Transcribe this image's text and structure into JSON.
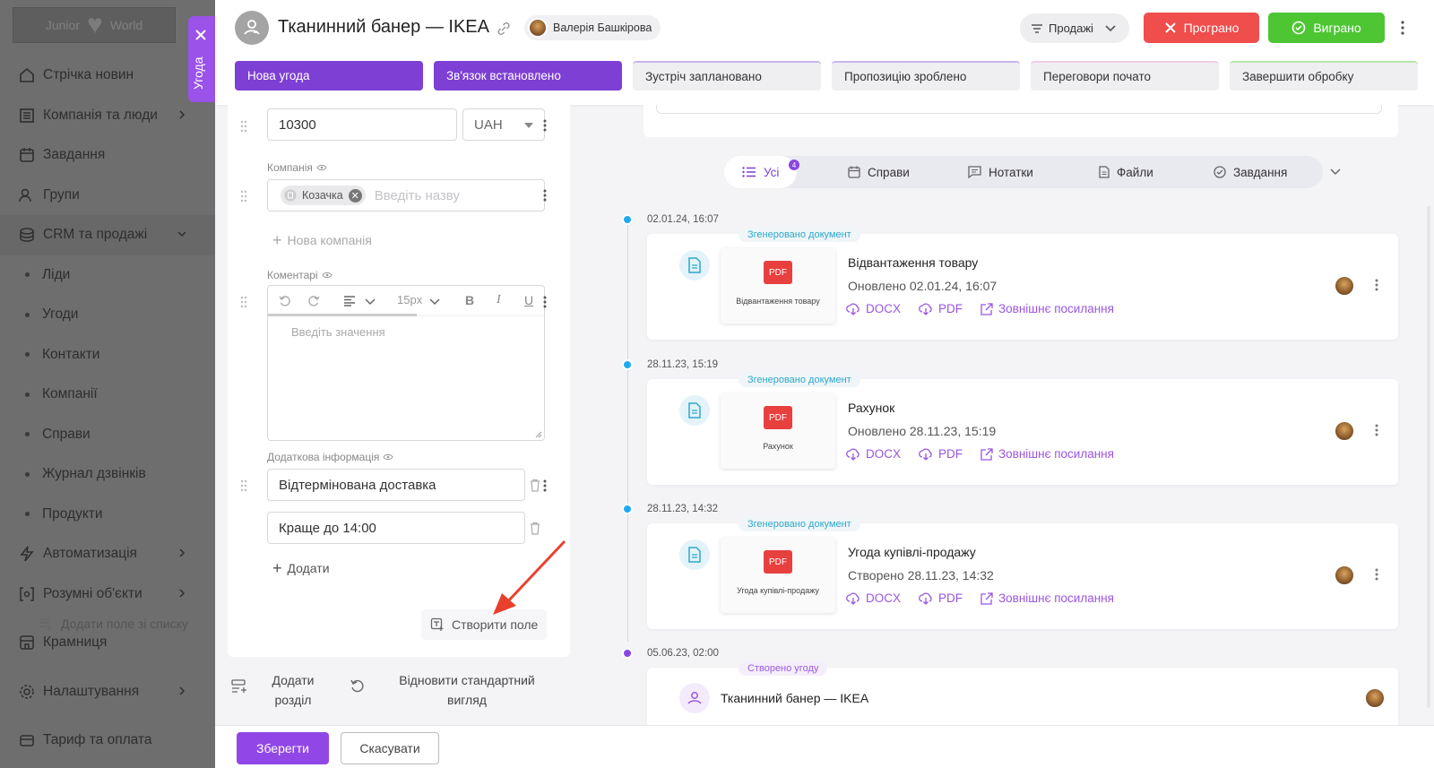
{
  "sidebar": {
    "logo_left": "Junior",
    "logo_right": "World",
    "items": [
      {
        "label": "Стрічка новин",
        "icon": "home-icon"
      },
      {
        "label": "Компанія та люди",
        "icon": "building-icon"
      },
      {
        "label": "Завдання",
        "icon": "calendar-icon"
      },
      {
        "label": "Групи",
        "icon": "users-icon"
      },
      {
        "label": "CRM та продажі",
        "icon": "coins-icon"
      },
      {
        "label": "Ліди"
      },
      {
        "label": "Угоди"
      },
      {
        "label": "Контакти"
      },
      {
        "label": "Компанії"
      },
      {
        "label": "Справи"
      },
      {
        "label": "Журнал дзвінків"
      },
      {
        "label": "Продукти"
      },
      {
        "label": "Автоматизація",
        "icon": "bolt-icon"
      },
      {
        "label": "Розумні об'єкти",
        "icon": "smart-object-icon"
      },
      {
        "label": "Крамниця",
        "icon": "store-icon"
      },
      {
        "label": "Налаштування",
        "icon": "gear-icon"
      },
      {
        "label": "Тариф та оплата",
        "icon": "payment-icon"
      }
    ]
  },
  "side_tab": {
    "label": "Угода"
  },
  "header": {
    "title": "Тканинний банер — IKEA",
    "responsible": "Валерія Башкірова",
    "pipeline": "Продажі",
    "lost_label": "Програно",
    "won_label": "Виграно"
  },
  "stages": [
    {
      "label": "Нова угода",
      "done": true
    },
    {
      "label": "Зв'язок встановлено",
      "done": true
    },
    {
      "label": "Зустріч заплановано",
      "done": false
    },
    {
      "label": "Пропозицію зроблено",
      "done": false
    },
    {
      "label": "Переговори почато",
      "done": false
    },
    {
      "label": "Завершити обробку",
      "done": false
    }
  ],
  "form": {
    "amount_value": "10300",
    "currency": "UAH",
    "company_label": "Компанія",
    "company_chip": "Козачка",
    "company_placeholder": "Введіть назву",
    "new_company": "Нова компанія",
    "comments_label": "Коментарі",
    "font_size": "15px",
    "bold": "B",
    "italic": "I",
    "underline": "U",
    "comments_placeholder": "Введіть значення",
    "extra_label": "Додаткова інформація",
    "extra_values": [
      "Відтермінована доставка",
      "Краще до 14:00"
    ],
    "add_label": "Додати",
    "add_from_list": "Додати поле зі списку",
    "create_field": "Створити поле",
    "add_section_1": "Додати",
    "add_section_2": "розділ",
    "restore_1": "Відновити стандартний",
    "restore_2": "вигляд",
    "save_label": "Зберегти",
    "cancel_label": "Скасувати"
  },
  "filters": {
    "all": "Усі",
    "all_count": "4",
    "tabs": [
      "Справи",
      "Нотатки",
      "Файли",
      "Завдання"
    ]
  },
  "timeline": [
    {
      "date": "02.01.24, 16:07",
      "tag": "Згенеровано документ",
      "thumb": "Відвантаження товару",
      "name": "Відвантаження товару",
      "sub": "Оновлено 02.01.24, 16:07"
    },
    {
      "date": "28.11.23, 15:19",
      "tag": "Згенеровано документ",
      "thumb": "Рахунок",
      "name": "Рахунок",
      "sub": "Оновлено 28.11.23, 15:19"
    },
    {
      "date": "28.11.23, 14:32",
      "tag": "Згенеровано документ",
      "thumb": "Угода купівлі-продажу",
      "name": "Угода купівлі-продажу",
      "sub": "Створено 28.11.23, 14:32"
    },
    {
      "date": "05.06.23, 02:00",
      "tag": "Створено угоду",
      "name": "Тканинний банер — IKEA"
    }
  ],
  "doc_links": {
    "docx": "DOCX",
    "pdf": "PDF",
    "external": "Зовнішнє посилання",
    "pdf_badge": "PDF"
  },
  "colors": {
    "accent": "#9147e6",
    "stage_done": "#7d3fd4",
    "lost": "#f04d4d",
    "won": "#4ec634",
    "timeline_dot": "#1eaaf1"
  }
}
